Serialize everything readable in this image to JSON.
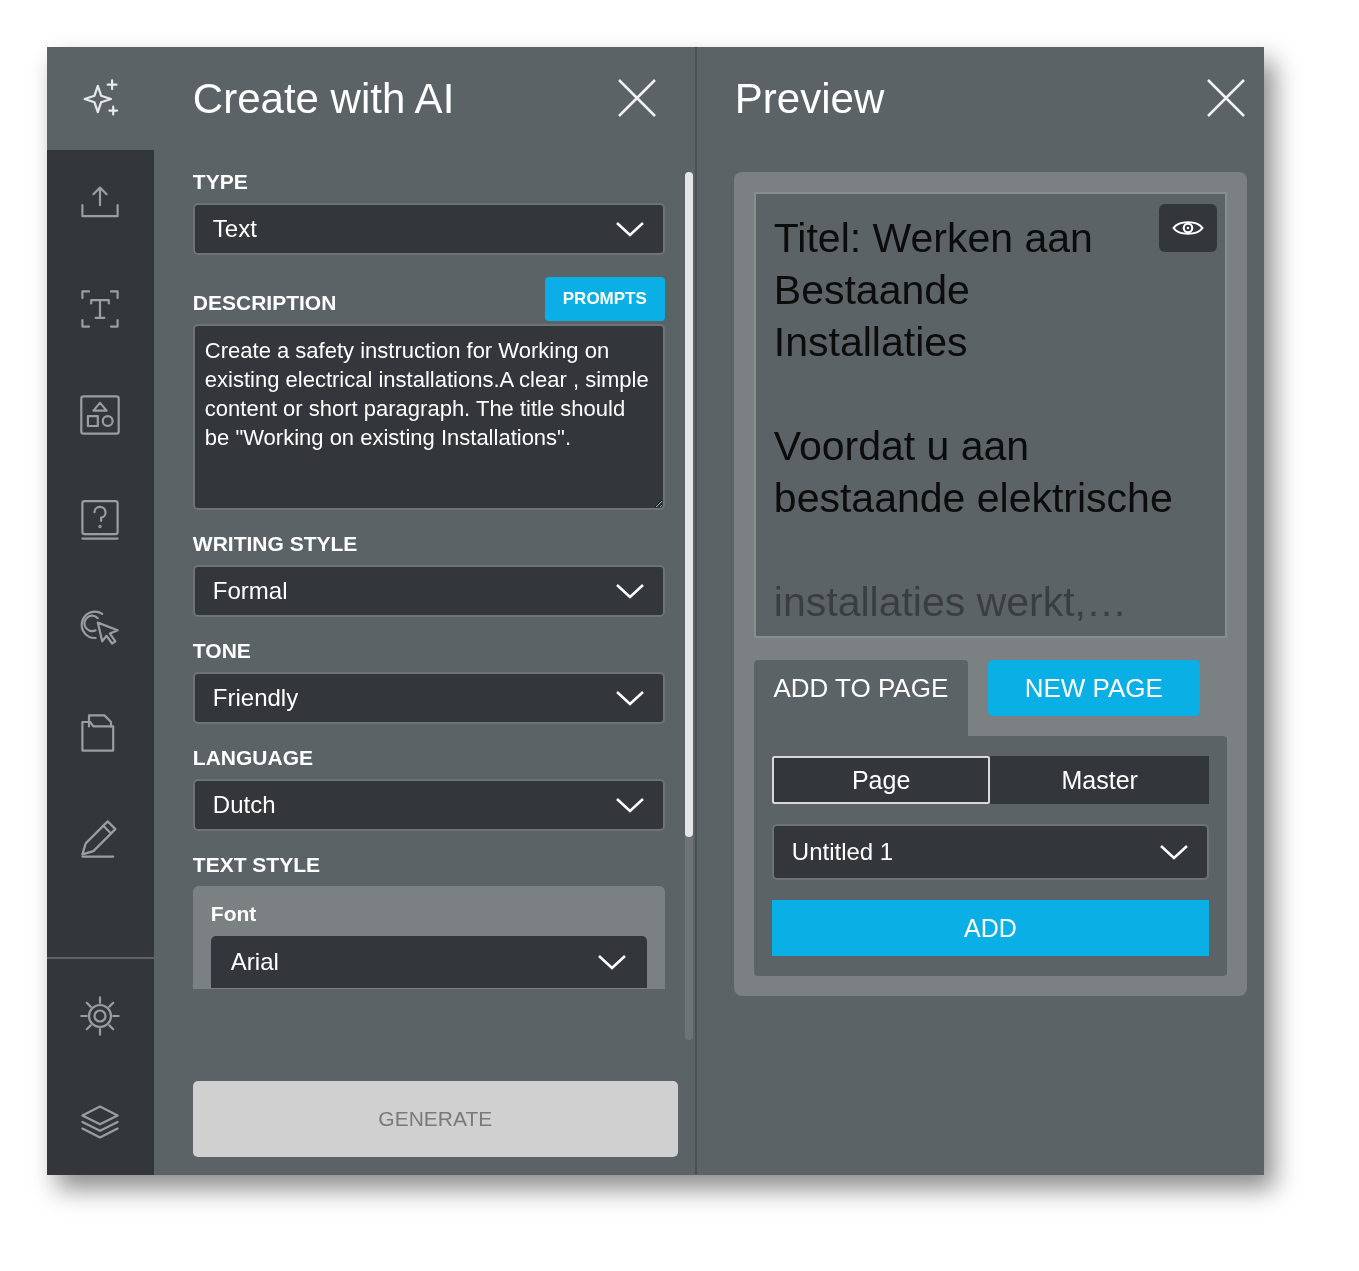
{
  "rail": {
    "top_items": [
      {
        "selected": true
      },
      {
        "selected": false
      },
      {
        "selected": false
      },
      {
        "selected": false
      },
      {
        "selected": false
      },
      {
        "selected": false
      },
      {
        "selected": false
      },
      {
        "selected": false
      }
    ],
    "bottom_items": [
      {
        "selected": false
      },
      {
        "selected": false
      }
    ]
  },
  "create_panel": {
    "title": "Create with AI",
    "fields": [
      {
        "kind": "select",
        "label": "TYPE",
        "value": "Text"
      },
      {
        "kind": "textarea",
        "label": "DESCRIPTION",
        "button": "PROMPTS",
        "value": "Create a safety instruction for Working on existing electrical installations.A clear , simple content or short paragraph. The title should be \"Working on existing Installations\"."
      },
      {
        "kind": "select",
        "label": "WRITING STYLE",
        "value": "Formal"
      },
      {
        "kind": "select",
        "label": "TONE",
        "value": "Friendly"
      },
      {
        "kind": "select",
        "label": "LANGUAGE",
        "value": "Dutch"
      },
      {
        "kind": "group",
        "label": "TEXT STYLE",
        "sub_label": "Font",
        "value": "Arial"
      }
    ],
    "generate_button": {
      "label": "GENERATE",
      "disabled": true
    }
  },
  "preview_panel": {
    "title": "Preview",
    "preview_text": [
      {
        "text": "Titel: Werken aan Bestaande Installaties",
        "faded": false
      },
      {
        "text": "Voordat u aan bestaande elektrische",
        "faded": false
      },
      {
        "text": "installaties werkt,…",
        "faded": true
      }
    ],
    "tabs": [
      {
        "label": "ADD TO PAGE",
        "selected": true
      },
      {
        "label": "NEW PAGE",
        "selected": false
      }
    ],
    "target_toggle": [
      {
        "label": "Page",
        "selected": true
      },
      {
        "label": "Master",
        "selected": false
      }
    ],
    "page_select": {
      "value": "Untitled 1"
    },
    "add_button": {
      "label": "ADD"
    }
  }
}
